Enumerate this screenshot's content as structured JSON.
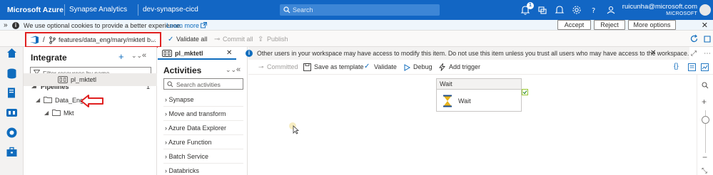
{
  "topbar": {
    "brand": "Microsoft Azure",
    "service": "Synapse Analytics",
    "workspace": "dev-synapse-cicd",
    "search_placeholder": "Search",
    "notification_count": "1",
    "user_email": "ruicunha@microsoft.com",
    "user_tenant": "MICROSOFT",
    "bg_color": "#1266c4"
  },
  "cookie_bar": {
    "text": "We use optional cookies to provide a better experience.",
    "learn_more": "Learn more",
    "accept": "Accept",
    "reject": "Reject",
    "more_options": "More options"
  },
  "toolbar": {
    "branch_sep": "/",
    "branch": "features/data_eng/mary/mktetl b...",
    "validate_all": "Validate all",
    "commit_all": "Commit all",
    "publish": "Publish"
  },
  "integrate": {
    "title": "Integrate",
    "filter_placeholder": "Filter resources by name",
    "pipelines_label": "Pipelines",
    "pipelines_count": "1",
    "tree": {
      "folder1": "Data_Eng",
      "folder2": "Mkt",
      "pipeline": "pl_mktetl"
    }
  },
  "pipeline_tab": {
    "label": "pl_mktetl"
  },
  "info_bar": {
    "text": "Other users in your workspace may have access to modify this item. Do not use this item unless you trust all users who may have access to the workspace."
  },
  "activities": {
    "title": "Activities",
    "search_placeholder": "Search activities",
    "items": [
      "Synapse",
      "Move and transform",
      "Azure Data Explorer",
      "Azure Function",
      "Batch Service",
      "Databricks"
    ]
  },
  "canvas_toolbar": {
    "committed": "Committed",
    "save_as_template": "Save as template",
    "validate": "Validate",
    "debug": "Debug",
    "add_trigger": "Add trigger"
  },
  "activity_card": {
    "header": "Wait",
    "name": "Wait"
  },
  "accent_color": "#0f6cbd",
  "annotation_color": "#e02020"
}
